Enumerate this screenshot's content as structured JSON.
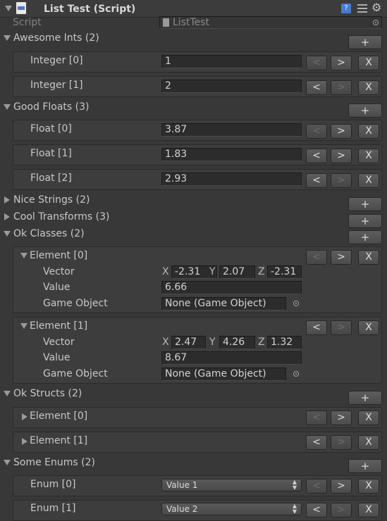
{
  "header": {
    "title": "List Test (Script)",
    "script_label": "Script",
    "script_value": "ListTest"
  },
  "sections": {
    "ints": {
      "label": "Awesome Ints (2)",
      "items": [
        {
          "label": "Integer [0]",
          "value": "1"
        },
        {
          "label": "Integer [1]",
          "value": "2"
        }
      ]
    },
    "floats": {
      "label": "Good Floats (3)",
      "items": [
        {
          "label": "Float [0]",
          "value": "3.87"
        },
        {
          "label": "Float [1]",
          "value": "1.83"
        },
        {
          "label": "Float [2]",
          "value": "2.93"
        }
      ]
    },
    "strings": {
      "label": "Nice Strings (2)"
    },
    "transforms": {
      "label": "Cool Transforms (3)"
    },
    "classes": {
      "label": "Ok Classes (2)",
      "items": [
        {
          "label": "Element [0]",
          "vector_label": "Vector",
          "x": "-2.31",
          "y": "2.07",
          "z": "-2.31",
          "value_label": "Value",
          "value": "6.66",
          "go_label": "Game Object",
          "go_value": "None (Game Object)"
        },
        {
          "label": "Element [1]",
          "vector_label": "Vector",
          "x": "2.47",
          "y": "4.26",
          "z": "1.32",
          "value_label": "Value",
          "value": "8.67",
          "go_label": "Game Object",
          "go_value": "None (Game Object)"
        }
      ]
    },
    "structs": {
      "label": "Ok Structs (2)",
      "items": [
        {
          "label": "Element [0]"
        },
        {
          "label": "Element [1]"
        }
      ]
    },
    "enums": {
      "label": "Some Enums (2)",
      "items": [
        {
          "label": "Enum [0]",
          "value": "Value 1"
        },
        {
          "label": "Enum [1]",
          "value": "Value 2"
        }
      ]
    }
  },
  "buttons": {
    "add": "+",
    "prev": "<",
    "next": ">",
    "remove": "X"
  },
  "axes": {
    "x": "X",
    "y": "Y",
    "z": "Z"
  }
}
